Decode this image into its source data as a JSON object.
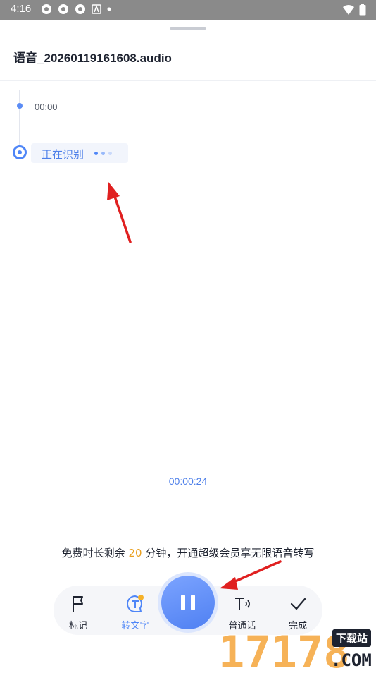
{
  "status_bar": {
    "time": "4:16",
    "icons": [
      "settings-icon",
      "settings-icon",
      "settings-icon",
      "font-icon",
      "dot-icon"
    ],
    "right_icons": [
      "wifi-icon",
      "battery-icon"
    ]
  },
  "sheet": {
    "title": "语音_20260119161608.audio",
    "timeline": {
      "timestamp": "00:00",
      "recognizing_label": "正在识别"
    },
    "elapsed_time": "00:00:24",
    "notice": {
      "prefix": "免费时长剩余",
      "minutes": "20",
      "suffix": "分钟，开通超级会员享无限语音转写"
    },
    "toolbar": {
      "mark_label": "标记",
      "to_text_label": "转文字",
      "mandarin_label": "普通话",
      "done_label": "完成"
    }
  },
  "colors": {
    "accent": "#4f86f7",
    "highlight_minutes": "#e9a020",
    "arrow": "#e02020"
  },
  "watermark": {
    "brand": "17178",
    "tagline": "下载站",
    "domain": ".COM"
  }
}
